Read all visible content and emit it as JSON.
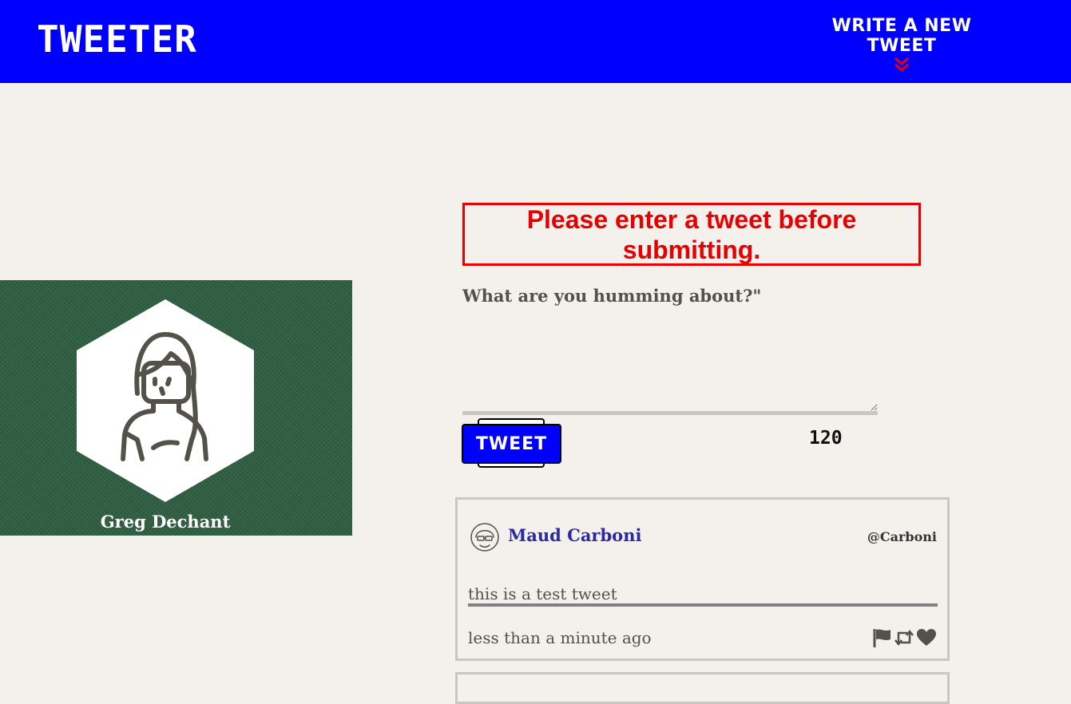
{
  "nav": {
    "brand": "TWEETER",
    "compose_label": "WRITE A NEW TWEET",
    "compose_icon": "double-chevron-down-icon"
  },
  "profile": {
    "name": "Greg Dechant",
    "avatar_icon": "user-avatar-icon"
  },
  "compose": {
    "error": "Please enter a tweet before submitting.",
    "prompt": "What are you humming about?\"",
    "textarea_value": "",
    "submit_label": "TWEET",
    "counter": "120"
  },
  "tweets": [
    {
      "name": "Maud Carboni",
      "handle": "@Carboni",
      "text": "this is a test tweet",
      "time": "less than a minute ago",
      "actions": [
        "flag-icon",
        "retweet-icon",
        "heart-icon"
      ]
    }
  ],
  "colors": {
    "nav": "#0000ff",
    "page": "#f4f1ec",
    "error": "#e80000",
    "profile": "#2e5e40",
    "author": "#2b29a3",
    "chevron": "#e80000"
  }
}
